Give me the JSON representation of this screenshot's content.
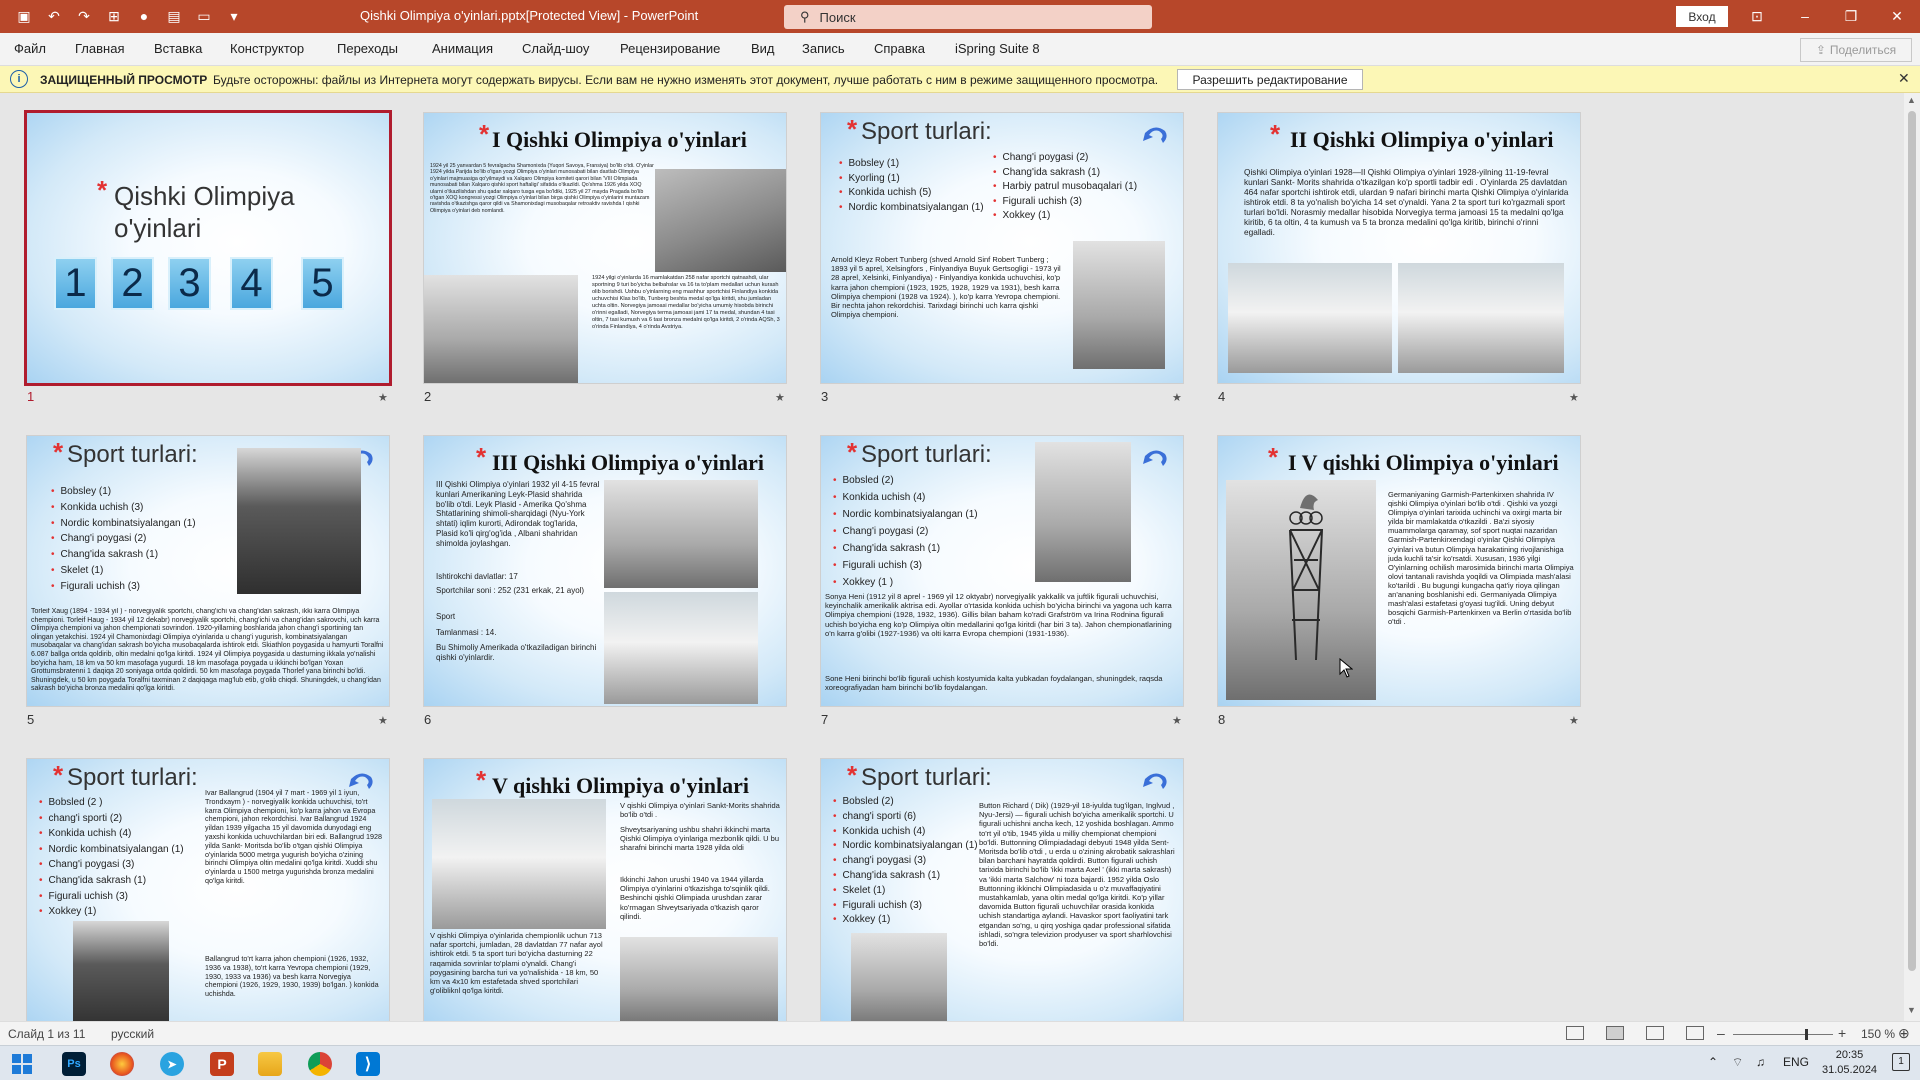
{
  "titlebar": {
    "document_title": "Qishki Olimpiya o'yinlari.pptx[Protected View]  -  PowerPoint",
    "search_placeholder": "Поиск",
    "signin": "Вход",
    "minimize": "–",
    "restore": "❐",
    "close": "✕",
    "ribbon_display": "⊡"
  },
  "menu": {
    "items": [
      "Файл",
      "Главная",
      "Вставка",
      "Конструктор",
      "Переходы",
      "Анимация",
      "Слайд-шоу",
      "Рецензирование",
      "Вид",
      "Запись",
      "Справка",
      "iSpring Suite 8"
    ],
    "share": "Поделиться"
  },
  "infobar": {
    "title": "ЗАЩИЩЕННЫЙ ПРОСМОТР",
    "message": "Будьте осторожны: файлы из Интернета могут содержать вирусы. Если вам не нужно изменять этот документ, лучше работать с ним в режиме защищенного просмотра.",
    "button": "Разрешить редактирование"
  },
  "slides": {
    "s1": {
      "title_line1": "Qishki Olimpiya",
      "title_line2": "o'yinlari",
      "nums": [
        "1",
        "2",
        "3",
        "4",
        "5"
      ]
    },
    "s2": {
      "title": "I Qishki Olimpiya o'yinlari",
      "text1": "1924 yil 25 yanvardan 5 fevralgacha Shamonixda (Yuqori Savoya, Fransiya) bo'lib o'tdi. O'yinlar 1924 yilda Parijda bo'lib o'tgan yozgi Olimpiya o'yinlari munosabati bilan dastlab Olimpiya o'yinlari majmuasiga qo'yilmaydi va Xalqaro Olimpiya komiteti qarori bilan 'VIII Olimpiada munosabati bilan Xalqaro qishki sport haftaligi' sifatida o'tkazildi. Qo'shma 1926 yilda XOQ ularni o'tkazilishdan shu qadar xalqaro tusga ega bo'ldiki, 1925 yil 27 mayda Pragada bo'lib o'tgan XOQ kongressi yozgi Olimpiya o'yinlari bilan birga qishki Olimpiya o'yinlarini muntazam ravishda o'tkazishga qaror qildi va Shamonixdagi musobaqalar retroaktiv ravishda I qishki Olimpiya o'yinlari deb nomlandi.",
      "text2": "1924 yilgi o'yinlarda 16 mamlakatdan 258 nafar sportchi qatnashdi, ular sportning 9 turi bo'yicha belbahslar va 16 ta to'plam medallari uchun kurash olib borishdi. Ushbu o'yinlarning eng mashhur sportchisi Finlandiya konkida uchuvchisi Klas bo'lib, Tunberg beshta medal qo'lga kiritdi, shu jumladan uchta oltin. Norvegiya jamoasi medallar bo'yicha umumiy hisobda birinchi o'rinni egalladi, Norvegiya terma jamoasi jami 17 ta medal, shundan 4 tasi oltin, 7 tasi kumush va 6 tasi bronza medalni qo'lga kiritdi, 2 o'rinda AQSh, 3 o'rinda Finlandiya, 4 o'rinda Avstriya."
    },
    "s3": {
      "title": "Sport turlari:",
      "left": [
        "Bobsley (1)",
        "Kyorling (1)",
        "Konkida uchish (5)",
        "Nordic kombinatsiyalangan (1)"
      ],
      "right": [
        "Chang'i poygasi (2)",
        "Chang'ida sakrash (1)",
        "Harbiy patrul musobaqalari (1)",
        "Figurali uchish (3)",
        "Xokkey (1)"
      ],
      "text": "Arnold Kleyz Robert Tunberg (shved Arnold Sinf Robert Tunberg ; 1893 yil 5 aprel, Xelsingfors , Finlyandiya Buyuk Gertsogligi - 1973 yil 28 aprel, Xelsinki, Finlyandiya) - Finlyandiya konkida uchuvchisi, ko'p karra jahon chempioni (1923, 1925, 1928, 1929 va 1931), besh karra Olimpiya chempioni (1928 va 1924). ), ko'p karra Yevropa chempioni. Bir nechta jahon rekordchisi. Tarixdagi birinchi uch karra qishki Olimpiya chempioni."
    },
    "s4": {
      "title": "II Qishki Olimpiya o'yinlari",
      "text": "Qishki Olimpiya o'yinlari 1928—II Qishki Olimpiya o'yinlari 1928-yilning 11-19-fevral kunlari Sankt- Morits shahrida o'tkazilgan ko'p sportli tadbir edi . O'yinlarda 25 davlatdan 464 nafar sportchi ishtirok etdi, ulardan 9 nafari birinchi marta Qishki Olimpiya o'yinlarida ishtirok etdi. 8 ta yo'nalish bo'yicha 14 set o'ynaldi. Yana 2 ta sport turi ko'rgazmali sport turlari bo'ldi. Norasmiy medallar hisobida Norvegiya terma jamoasi 15 ta medalni qo'lga kiritib, 6 ta oltin, 4 ta kumush va 5 ta bronza medalini qo'lga kiritib, birinchi o'rinni egalladi."
    },
    "s5": {
      "title": "Sport turlari:",
      "list": [
        "Bobsley (1)",
        "Konkida uchish (3)",
        "Nordic kombinatsiyalangan (1)",
        "Chang'i poygasi (2)",
        "Chang'ida sakrash (1)",
        "Skelet (1)",
        "Figurali uchish (3)"
      ],
      "text": "Torleif Xaug (1894 - 1934 yil ) - norvegiyalik sportchi, chang'ichi va chang'idan sakrash, ikki karra Olimpiya chempioni. Torleif Haug - 1934 yil 12 dekabr) norvegiyalik sportchi, chang'ichi va chang'idan sakrovchi, uch karra Olimpiya chempioni va jahon chempionati sovrindori. 1920-yillarning boshlarida jahon chang'i sportining tan olingan yetakchisi. 1924 yil Chamonixdagi Olimpiya o'yinlarida u chang'i yugurish, kombinatsiyalangan musobaqalar va chang'idan sakrash bo'yicha musobaqalarda ishtirok etdi. Skiathlon poygasida u hamyurti Toralfni 6.087 ballga ortda qoldirib, oltin medalni qo'lga kiritdi. 1924 yil Olimpiya poygasida u dasturning ikkala yo'nalishi bo'yicha ham, 18 km va 50 km masofaga yugurdi. 18 km masofaga poygada u ikkinchi bo'lgan Yoxan Grottumsbratenni 1 daqiqa 20 soniyaga ortda qoldirdi. 50 km masofaga poygada Thorlef yana birinchi bo'ldi. Shuningdek, u 50 km poygada Toralfni taxminan 2 daqiqaga mag'lub etib, g'olib chiqdi. Shuningdek, u chang'idan sakrash bo'yicha bronza medalini qo'lga kiritdi."
    },
    "s6": {
      "title": "III Qishki Olimpiya o'yinlari",
      "p1": "III Qishki Olimpiya o'yinlari 1932 yil 4-15 fevral kunlari Amerikaning Leyk-Plasid shahrida bo'lib o'tdi. Leyk Plasid - Amerika Qo'shma Shtatlarining shimoli-sharqidagi (Nyu-York shtati) iqlim kurorti, Adirondak tog'larida, Plasid ko'li qirg'og'ida , Albani shahridan shimolda joylashgan.",
      "p2": "Ishtirokchi davlatlar: 17",
      "p3": "Sportchilar soni : 252 (231 erkak, 21 ayol)",
      "p4": "Sport",
      "p5": "Tamlanmasi : 14.",
      "p6": "Bu Shimoliy Amerikada o'tkaziladigan birinchi qishki o'yinlardir."
    },
    "s7": {
      "title": "Sport turlari:",
      "list": [
        "Bobsled (2)",
        "Konkida uchish (4)",
        "Nordic kombinatsiyalangan (1)",
        "Chang'i poygasi (2)",
        "Chang'ida sakrash (1)",
        "Figurali uchish (3)",
        "Xokkey (1 )"
      ],
      "text1": "Sonya Heni (1912 yil 8 aprel - 1969 yil 12 oktyabr) norvegiyalik yakkalik va juftlik figurali uchuvchisi, keyinchalik amerikalik aktrisa edi. Ayollar o'rtasida konkida uchish bo'yicha birinchi va yagona uch karra Olimpiya chempioni (1928, 1932, 1936). Gillis bilan baham ko'radi Grafström va Irina Rodnina figurali uchish bo'yicha eng ko'p Olimpiya oltin medallarini qo'lga kiritdi (har biri 3 ta). Jahon chempionatlarining o'n karra g'olibi (1927-1936) va olti karra Evropa chempioni (1931-1936).",
      "text2": "Sone Heni birinchi bo'lib figurali uchish kostyumida kalta yubkadan foydalangan, shuningdek, raqsda xoreografiyadan ham birinchi bo'lib foydalangan."
    },
    "s8": {
      "title": "I V qishki Olimpiya o'yinlari",
      "text": "Germaniyaning Garmish-Partenkirxen shahrida IV qishki Olimpiya o'yinlari bo'lib o'tdi . Qishki va yozgi Olimpiya o'yinlari tarixida uchinchi va oxirgi marta bir yilda bir mamlakatda o'tkazildi . Ba'zi siyosiy muammolarga qaramay, sof sport nuqtai nazaridan Garmish-Partenkirxendagi o'yinlar Qishki Olimpiya o'yinlari va butun Olimpiya harakatining rivojlanishiga juda kuchli ta'sir ko'rsatdi. Xususan, 1936 yilgi O'yinlarning ochilish marosimida birinchi marta Olimpiya olovi tantanali ravishda yoqildi va Olimpiada mash'alasi ko'tarildi . Bu bugungi kungacha qat'iy rioya qilingan an'ananing boshlanishi edi. Germaniyada Olimpiya mash'alasi estafetasi g'oyasi tug'ildi. Uning debyut bosqichi Garmish-Partenkirxen va Berlin o'rtasida bo'lib o'tdi ."
    },
    "s9": {
      "title": "Sport turlari:",
      "list": [
        "Bobsled (2 )",
        "chang'i sporti (2)",
        "Konkida uchish (4)",
        "Nordic kombinatsiyalangan (1)",
        "Chang'i poygasi (3)",
        "Chang'ida sakrash (1)",
        "Figurali uchish (3)",
        "Xokkey (1)"
      ],
      "text1": "Ivar Ballangrud (1904 yil 7 mart - 1969 yil 1 iyun, Trondxaym ) - norvegiyalik konkida uchuvchisi, to'rt karra Olimpiya chempioni, ko'p karra jahon va Evropa chempioni, jahon rekordchisi. Ivar Ballangrud 1924 yildan 1939 yilgacha 15 yil davomida dunyodagi eng yaxshi konkida uchuvchilardan biri edi. Ballangrud 1928 yilda Sankt- Moritsda bo'lib o'tgan qishki Olimpiya o'yinlarida 5000 metrga yugurish bo'yicha o'zining birinchi Olimpiya oltin medalini qo'lga kiritdi. Xuddi shu o'yinlarda u 1500 metrga yugurishda bronza medalini qo'lga kiritdi.",
      "text2": "Ballangrud to'rt karra jahon chempioni (1926, 1932, 1936 va 1938), to'rt karra Yevropa chempioni (1929, 1930, 1933 va 1936) va besh karra Norvegiya chempioni (1926, 1929, 1930, 1939) bo'lgan. ) konkida uchishda."
    },
    "s10": {
      "title": "V qishki Olimpiya o'yinlari",
      "p1": "V qishki Olimpiya o'yinlari Sankt-Morits shahrida bo'lib o'tdi .",
      "p2": "Shveytsariyaning ushbu shahri ikkinchi marta Qishki Olimpiya o'yinlariga mezbonlik qildi. U bu sharafni birinchi marta 1928 yilda oldi",
      "p3": "Ikkinchi Jahon urushi 1940 va 1944 yillarda Olimpiya o'yinlarini o'tkazishga to'sqinlik qildi. Beshinchi qishki Olimpiada urushdan zarar ko'rmagan Shveytsariyada o'tkazish qaror qilindi.",
      "p4": "V qishki Olimpiya o'yinlarida chempionlik uchun 713 nafar sportchi, jumladan, 28 davlatdan 77 nafar ayol ishtirok etdi. 5 ta sport turi bo'yicha dasturning 22 raqamida sovrinlar to'plami o'ynaldi. Chang'i poygasining barcha turi va yo'nalishida - 18 km, 50 km va 4x10 km estafetada shved sportchilari g'olibliknl qo'lga kiritdi."
    },
    "s11": {
      "title": "Sport turlari:",
      "list": [
        "Bobsled (2)",
        "chang'i sporti (6)",
        "Konkida uchish (4)",
        "Nordic kombinatsiyalangan (1)",
        "chang'i poygasi (3)",
        "Chang'ida sakrash (1)",
        "Skelet (1)",
        "Figurali uchish (3)",
        "Xokkey (1)"
      ],
      "text": "Button Richard ( Dik) (1929-yil 18-iyulda tug'ilgan, Inglvud , Nyu-Jersi) — figurali uchish bo'yicha amerikalik sportchi. U figurali uchishni ancha kech, 12 yoshida boshlagan. Ammo to'rt yil o'tib, 1945 yilda u milliy chempionat chempioni bo'ldi. Buttonning Olimpiadadagi debyuti 1948 yilda Sent- Moritsda bo'lib o'tdi , u erda u o'zining akrobatik sakrashlari bilan barchani hayratda qoldirdi. Button figurali uchish tarixida birinchi bo'lib 'ikki marta Axel ' (ikki marta sakrash) va 'ikki marta Salchow' ni toza bajardi. 1952 yilda Oslo Buttonning ikkinchi Olimpiadasida u o'z muvaffaqiyatini mustahkamlab, yana oltin medal qo'lga kiritdi. Ko'p yillar davomida Button figurali uchuvchilar orasida konkida uchish standartiga aylandi. Havaskor sport faoliyatini tark etgandan so'ng, u qirq yoshiga qadar professional sifatida ishladi, so'ngra televizion prodyuser va sport sharhlovchisi bo'ldi."
    },
    "numbers": [
      "1",
      "2",
      "3",
      "4",
      "5",
      "6",
      "7",
      "8"
    ]
  },
  "status": {
    "slide_counter": "Слайд 1 из 11",
    "language": "русский",
    "zoom_minus": "–",
    "zoom_plus": "+",
    "zoom": "150 %"
  },
  "taskbar": {
    "ps_label": "Ps",
    "ppt_label": "P",
    "vscode_label": "⟩",
    "lang": "ENG",
    "time": "20:35",
    "date": "31.05.2024",
    "notif_count": "1"
  },
  "colors": {
    "titlebar": "#b7472a",
    "selection": "#b01c2e",
    "infobar": "#fcf7b6"
  }
}
